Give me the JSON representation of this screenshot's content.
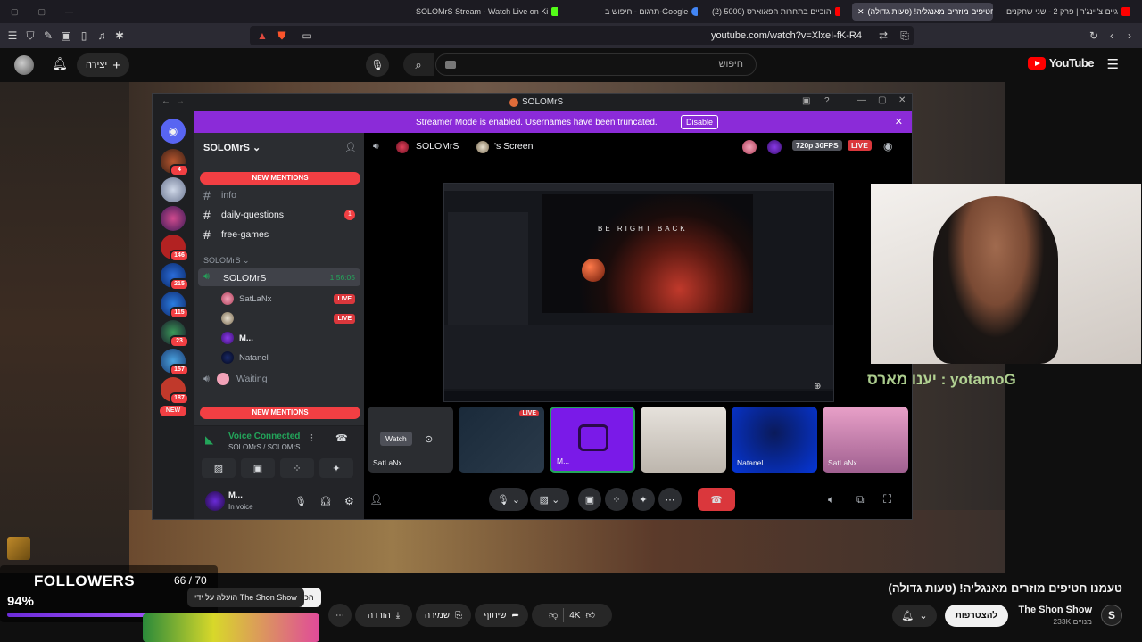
{
  "browser": {
    "tabs": [
      {
        "label": "SOLOMrS Stream - Watch Live on Ki",
        "color": "#53fc18"
      },
      {
        "label": "תרגום - חיפוש ב-Google",
        "color": "#4285f4"
      },
      {
        "label": "(2) הוכיים בתחרות הפאוארס (5000",
        "color": "#ff0000"
      },
      {
        "label": "טעמנו חטיפים מוזרים מאנגליה! (טעות גדולה) - YouTube",
        "color": "#ff0000"
      },
      {
        "label": "גיים צ'יינג'ר | פרק 2 - שני שחקנים",
        "color": "#ff0000"
      }
    ],
    "url": "youtube.com/watch?v=XlxeI-fK-R4"
  },
  "yt_header": {
    "search_placeholder": "חיפוש",
    "create_label": "יצירה",
    "logo_text": "YouTube"
  },
  "discord": {
    "window_title": "SOLOMrS",
    "streamer_banner": "Streamer Mode is enabled. Usernames have been truncated.",
    "disable_label": "Disable",
    "guild_badges": [
      "4",
      "146",
      "215",
      "115",
      "23",
      "157",
      "187",
      "NEW"
    ],
    "server_name": "SOLOMrS",
    "new_mentions": "NEW MENTIONS",
    "channels": [
      {
        "icon": "#",
        "name": "info",
        "badge": ""
      },
      {
        "icon": "#",
        "name": "daily-questions",
        "badge": "1"
      },
      {
        "icon": "#",
        "name": "free-games",
        "badge": ""
      }
    ],
    "category": "SOLOMrS",
    "voice_channel": {
      "name": "SOLOMrS",
      "timer": "1:56:05"
    },
    "members": [
      {
        "name": "SatLaNx",
        "live": "LIVE"
      },
      {
        "name": "",
        "live": "LIVE"
      },
      {
        "name": "M...",
        "live": ""
      },
      {
        "name": "Natanel",
        "live": ""
      }
    ],
    "waiting_channel": "Waiting",
    "voice_panel": {
      "title": "Voice Connected",
      "sub": "SOLOMrS / SOLOMrS"
    },
    "user_panel": {
      "name": "M...",
      "status": "In voice"
    },
    "stage": {
      "user": "SOLOMrS",
      "screen_label": "'s Screen",
      "quality": "720p 30FPS",
      "live": "LIVE",
      "brb_text": "BE RIGHT BACK"
    },
    "tiles": [
      {
        "label": "SatLaNx",
        "watch": "Watch",
        "live": ""
      },
      {
        "label": "",
        "watch": "",
        "live": "LIVE"
      },
      {
        "label": "M...",
        "watch": "",
        "live": ""
      },
      {
        "label": "",
        "watch": "",
        "live": ""
      },
      {
        "label": "Natanel",
        "watch": "",
        "live": ""
      },
      {
        "label": "SatLaNx",
        "watch": "",
        "live": ""
      }
    ]
  },
  "overlay": {
    "chat_message": "יענו מארס : yotamoG",
    "followers_title": "FOLLOWERS",
    "followers_count": "66 / 70",
    "followers_percent": "94%",
    "followers_progress": 0.94
  },
  "video_info": {
    "title": "טעמנו חטיפים מוזרים מאנגליה! (טעות גדולה)",
    "channel": "The Shon Show",
    "subs": "233K מנויים",
    "subscribe_label": "להצטרפות",
    "likes": "4K",
    "share_label": "שיתוף",
    "save_label": "שמירה",
    "download_label": "הורדה",
    "chips": [
      "הכול",
      "הועלה על ידי The Shon Show",
      "קשורים",
      "בשבילך",
      "הועלו ל"
    ]
  }
}
